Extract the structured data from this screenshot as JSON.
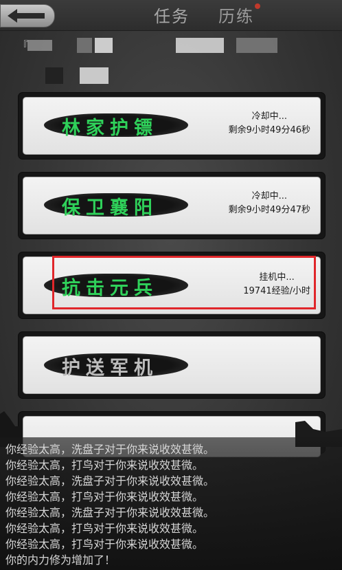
{
  "header": {
    "tab_task": "任务",
    "tab_training": "历练"
  },
  "info": {
    "bracket": "『"
  },
  "tasks": [
    {
      "name": "林家护镖",
      "status_line1": "冷却中...",
      "status_line2": "剩余9小时49分46秒",
      "name_color": "#2fd15a"
    },
    {
      "name": "保卫襄阳",
      "status_line1": "冷却中...",
      "status_line2": "剩余9小时49分47秒",
      "name_color": "#2fd15a"
    },
    {
      "name": "抗击元兵",
      "status_line1": "挂机中...",
      "status_line2": "19741经验/小时",
      "name_color": "#2fd15a"
    },
    {
      "name": "护送军机",
      "status_line1": "",
      "status_line2": "",
      "name_color": "#bdbdbd"
    }
  ],
  "log": [
    "你经验太高，洗盘子对于你来说收效甚微。",
    "你经验太高，打鸟对于你来说收效甚微。",
    "你经验太高，洗盘子对于你来说收效甚微。",
    "你经验太高，打鸟对于你来说收效甚微。",
    "你经验太高，洗盘子对于你来说收效甚微。",
    "你经验太高，打鸟对于你来说收效甚微。",
    "你经验太高，打鸟对于你来说收效甚微。",
    "你的内力修为增加了！"
  ],
  "colors": {
    "highlight_border": "#e0262a",
    "active_name": "#2fd15a",
    "new_indicator": "#c0392b"
  }
}
